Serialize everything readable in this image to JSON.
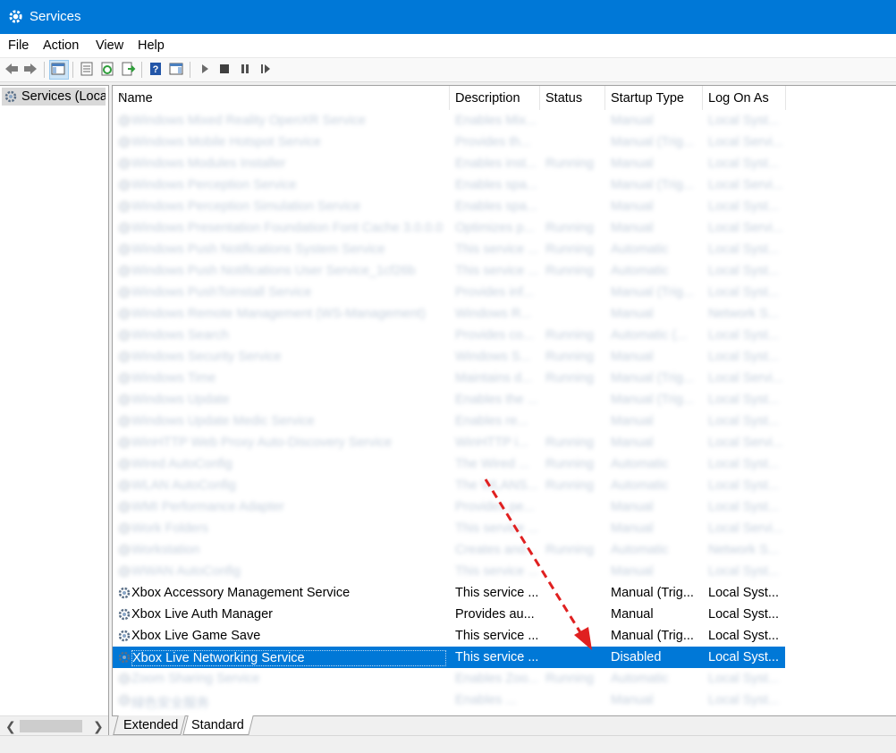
{
  "window": {
    "title": "Services"
  },
  "menu": [
    "File",
    "Action",
    "View",
    "Help"
  ],
  "toolbar": [
    {
      "name": "back-icon"
    },
    {
      "name": "forward-icon"
    },
    {
      "name": "show-hide-console-tree-icon"
    },
    {
      "name": "properties-icon"
    },
    {
      "name": "refresh-icon"
    },
    {
      "name": "export-list-icon"
    },
    {
      "name": "help-icon"
    },
    {
      "name": "show-hide-action-pane-icon"
    },
    {
      "name": "start-service-icon"
    },
    {
      "name": "stop-service-icon"
    },
    {
      "name": "pause-service-icon"
    },
    {
      "name": "restart-service-icon"
    }
  ],
  "tree": {
    "root_label": "Services (Loca"
  },
  "columns": [
    "Name",
    "Description",
    "Status",
    "Startup Type",
    "Log On As"
  ],
  "rows": [
    {
      "name": "Windows Mixed Reality OpenXR Service",
      "desc": "Enables Mix...",
      "status": "",
      "startup": "Manual",
      "logon": "Local Syst...",
      "blurred": true
    },
    {
      "name": "Windows Mobile Hotspot Service",
      "desc": "Provides th...",
      "status": "",
      "startup": "Manual (Trig...",
      "logon": "Local Servi...",
      "blurred": true
    },
    {
      "name": "Windows Modules Installer",
      "desc": "Enables inst...",
      "status": "Running",
      "startup": "Manual",
      "logon": "Local Syst...",
      "blurred": true
    },
    {
      "name": "Windows Perception Service",
      "desc": "Enables spa...",
      "status": "",
      "startup": "Manual (Trig...",
      "logon": "Local Servi...",
      "blurred": true
    },
    {
      "name": "Windows Perception Simulation Service",
      "desc": "Enables spa...",
      "status": "",
      "startup": "Manual",
      "logon": "Local Syst...",
      "blurred": true
    },
    {
      "name": "Windows Presentation Foundation Font Cache 3.0.0.0",
      "desc": "Optimizes p...",
      "status": "Running",
      "startup": "Manual",
      "logon": "Local Servi...",
      "blurred": true
    },
    {
      "name": "Windows Push Notifications System Service",
      "desc": "This service ...",
      "status": "Running",
      "startup": "Automatic",
      "logon": "Local Syst...",
      "blurred": true
    },
    {
      "name": "Windows Push Notifications User Service_1cf26b",
      "desc": "This service ...",
      "status": "Running",
      "startup": "Automatic",
      "logon": "Local Syst...",
      "blurred": true
    },
    {
      "name": "Windows PushToInstall Service",
      "desc": "Provides inf...",
      "status": "",
      "startup": "Manual (Trig...",
      "logon": "Local Syst...",
      "blurred": true
    },
    {
      "name": "Windows Remote Management (WS-Management)",
      "desc": "Windows R...",
      "status": "",
      "startup": "Manual",
      "logon": "Network S...",
      "blurred": true
    },
    {
      "name": "Windows Search",
      "desc": "Provides co...",
      "status": "Running",
      "startup": "Automatic (...",
      "logon": "Local Syst...",
      "blurred": true
    },
    {
      "name": "Windows Security Service",
      "desc": "Windows S...",
      "status": "Running",
      "startup": "Manual",
      "logon": "Local Syst...",
      "blurred": true
    },
    {
      "name": "Windows Time",
      "desc": "Maintains d...",
      "status": "Running",
      "startup": "Manual (Trig...",
      "logon": "Local Servi...",
      "blurred": true
    },
    {
      "name": "Windows Update",
      "desc": "Enables the ...",
      "status": "",
      "startup": "Manual (Trig...",
      "logon": "Local Syst...",
      "blurred": true
    },
    {
      "name": "Windows Update Medic Service",
      "desc": "Enables re...",
      "status": "",
      "startup": "Manual",
      "logon": "Local Syst...",
      "blurred": true
    },
    {
      "name": "WinHTTP Web Proxy Auto-Discovery Service",
      "desc": "WinHTTP i...",
      "status": "Running",
      "startup": "Manual",
      "logon": "Local Servi...",
      "blurred": true
    },
    {
      "name": "Wired AutoConfig",
      "desc": "The Wired ...",
      "status": "Running",
      "startup": "Automatic",
      "logon": "Local Syst...",
      "blurred": true
    },
    {
      "name": "WLAN AutoConfig",
      "desc": "The WLANS...",
      "status": "Running",
      "startup": "Automatic",
      "logon": "Local Syst...",
      "blurred": true
    },
    {
      "name": "WMI Performance Adapter",
      "desc": "Provides pe...",
      "status": "",
      "startup": "Manual",
      "logon": "Local Syst...",
      "blurred": true
    },
    {
      "name": "Work Folders",
      "desc": "This service ...",
      "status": "",
      "startup": "Manual",
      "logon": "Local Servi...",
      "blurred": true
    },
    {
      "name": "Workstation",
      "desc": "Creates and...",
      "status": "Running",
      "startup": "Automatic",
      "logon": "Network S...",
      "blurred": true
    },
    {
      "name": "WWAN AutoConfig",
      "desc": "This service ...",
      "status": "",
      "startup": "Manual",
      "logon": "Local Syst...",
      "blurred": true
    },
    {
      "name": "Xbox Accessory Management Service",
      "desc": "This service ...",
      "status": "",
      "startup": "Manual (Trig...",
      "logon": "Local Syst...",
      "blurred": false
    },
    {
      "name": "Xbox Live Auth Manager",
      "desc": "Provides au...",
      "status": "",
      "startup": "Manual",
      "logon": "Local Syst...",
      "blurred": false
    },
    {
      "name": "Xbox Live Game Save",
      "desc": "This service ...",
      "status": "",
      "startup": "Manual (Trig...",
      "logon": "Local Syst...",
      "blurred": false
    },
    {
      "name": "Xbox Live Networking Service",
      "desc": "This service ...",
      "status": "",
      "startup": "Disabled",
      "logon": "Local Syst...",
      "blurred": false,
      "selected": true
    },
    {
      "name": "Zoom Sharing Service",
      "desc": "Enables Zoo...",
      "status": "Running",
      "startup": "Automatic",
      "logon": "Local Syst...",
      "blurred": true
    },
    {
      "name": "緑色安全服务",
      "desc": "Enables ...",
      "status": "",
      "startup": "Manual",
      "logon": "Local Syst...",
      "blurred": true
    }
  ],
  "tabs": [
    "Extended",
    "Standard"
  ],
  "annotation": {
    "color": "#e02020"
  },
  "colors": {
    "accent": "#0078d7",
    "selection": "#0078d7"
  }
}
